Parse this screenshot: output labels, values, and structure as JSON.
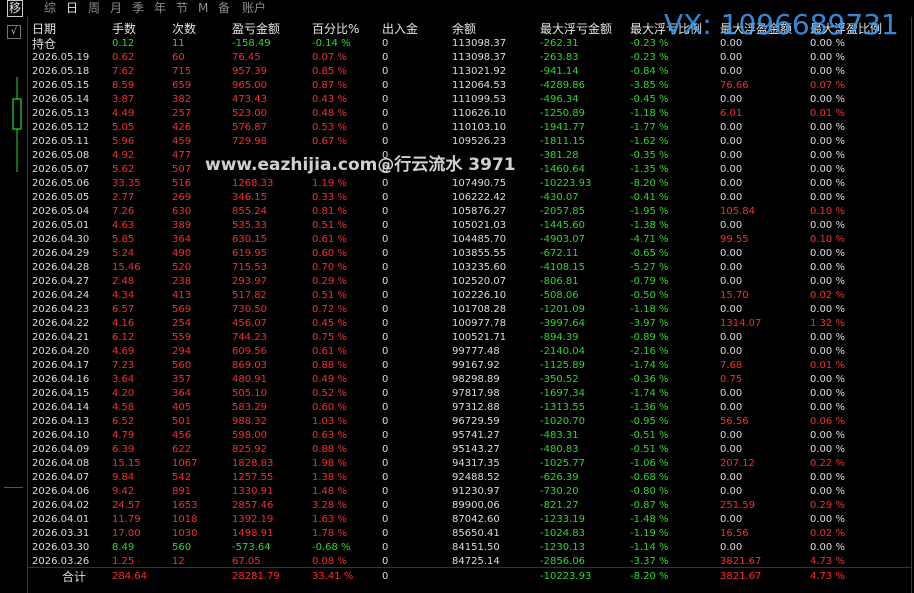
{
  "tabs": [
    "移",
    "综",
    "日",
    "周",
    "月",
    "季",
    "年",
    "节",
    "M",
    "备",
    "账户"
  ],
  "left_button": "√",
  "watermark": "www.eazhijia.com@行云流水 3971",
  "vx_watermark": "VX: 1096689731",
  "columns": [
    "日期",
    "手数",
    "次数",
    "盈亏金额",
    "百分比%",
    "出入金",
    "余额",
    "最大浮亏金额",
    "最大浮亏比例",
    "最大浮盈金额",
    "最大浮盈比例"
  ],
  "rows": [
    [
      "持仓",
      "0.12",
      "11",
      "-158.49",
      "-0.14 %",
      "0",
      "113098.37",
      "-262.31",
      "-0.23 %",
      "0.00",
      "0.00 %"
    ],
    [
      "2026.05.19",
      "0.62",
      "60",
      "76.45",
      "0.07 %",
      "0",
      "113098.37",
      "-263.83",
      "-0.23 %",
      "0.00",
      "0.00 %"
    ],
    [
      "2026.05.18",
      "7.62",
      "715",
      "957.39",
      "0.85 %",
      "0",
      "113021.92",
      "-941.14",
      "-0.84 %",
      "0.00",
      "0.00 %"
    ],
    [
      "2026.05.15",
      "8.59",
      "659",
      "965.00",
      "0.87 %",
      "0",
      "112064.53",
      "-4289.86",
      "-3.85 %",
      "76.66",
      "0.07 %"
    ],
    [
      "2026.05.14",
      "3.87",
      "382",
      "473.43",
      "0.43 %",
      "0",
      "111099.53",
      "-496.34",
      "-0.45 %",
      "0.00",
      "0.00 %"
    ],
    [
      "2026.05.13",
      "4.49",
      "257",
      "523.00",
      "0.48 %",
      "0",
      "110626.10",
      "-1250.89",
      "-1.18 %",
      "6.01",
      "0.01 %"
    ],
    [
      "2026.05.12",
      "5.05",
      "426",
      "576.87",
      "0.53 %",
      "0",
      "110103.10",
      "-1941.77",
      "-1.77 %",
      "0.00",
      "0.00 %"
    ],
    [
      "2026.05.11",
      "5.96",
      "459",
      "729.98",
      "0.67 %",
      "0",
      "109526.23",
      "-1811.15",
      "-1.62 %",
      "0.00",
      "0.00 %"
    ],
    [
      "2026.05.08",
      "4.92",
      "477",
      "",
      "",
      "0",
      "",
      "-381.28",
      "-0.35 %",
      "0.00",
      "0.00 %"
    ],
    [
      "2026.05.07",
      "5.62",
      "507",
      "",
      "",
      "0",
      "",
      "-1460.64",
      "-1.35 %",
      "0.00",
      "0.00 %"
    ],
    [
      "2026.05.06",
      "33.35",
      "516",
      "1268.33",
      "1.19 %",
      "0",
      "107490.75",
      "-10223.93",
      "-8.20 %",
      "0.00",
      "0.00 %"
    ],
    [
      "2026.05.05",
      "2.77",
      "269",
      "346.15",
      "0.33 %",
      "0",
      "106222.42",
      "-430.07",
      "-0.41 %",
      "0.00",
      "0.00 %"
    ],
    [
      "2026.05.04",
      "7.26",
      "630",
      "855.24",
      "0.81 %",
      "0",
      "105876.27",
      "-2057.85",
      "-1.95 %",
      "105.84",
      "0.10 %"
    ],
    [
      "2026.05.01",
      "4.63",
      "389",
      "535.33",
      "0.51 %",
      "0",
      "105021.03",
      "-1445.60",
      "-1.38 %",
      "0.00",
      "0.00 %"
    ],
    [
      "2026.04.30",
      "5.85",
      "364",
      "630.15",
      "0.61 %",
      "0",
      "104485.70",
      "-4903.07",
      "-4.71 %",
      "99.55",
      "0.10 %"
    ],
    [
      "2026.04.29",
      "5.24",
      "490",
      "619.95",
      "0.60 %",
      "0",
      "103855.55",
      "-672.11",
      "-0.65 %",
      "0.00",
      "0.00 %"
    ],
    [
      "2026.04.28",
      "15.46",
      "520",
      "715.53",
      "0.70 %",
      "0",
      "103235.60",
      "-4108.15",
      "-5.27 %",
      "0.00",
      "0.00 %"
    ],
    [
      "2026.04.27",
      "2.48",
      "238",
      "293.97",
      "0.29 %",
      "0",
      "102520.07",
      "-806.81",
      "-0.79 %",
      "0.00",
      "0.00 %"
    ],
    [
      "2026.04.24",
      "4.34",
      "413",
      "517.82",
      "0.51 %",
      "0",
      "102226.10",
      "-508.06",
      "-0.50 %",
      "15.70",
      "0.02 %"
    ],
    [
      "2026.04.23",
      "6.57",
      "569",
      "730.50",
      "0.72 %",
      "0",
      "101708.28",
      "-1201.09",
      "-1.18 %",
      "0.00",
      "0.00 %"
    ],
    [
      "2026.04.22",
      "4.16",
      "254",
      "456.07",
      "0.45 %",
      "0",
      "100977.78",
      "-3997.64",
      "-3.97 %",
      "1314.07",
      "1.32 %"
    ],
    [
      "2026.04.21",
      "6.12",
      "559",
      "744.23",
      "0.75 %",
      "0",
      "100521.71",
      "-894.39",
      "-0.89 %",
      "0.00",
      "0.00 %"
    ],
    [
      "2026.04.20",
      "4.69",
      "294",
      "609.56",
      "0.61 %",
      "0",
      "99777.48",
      "-2140.04",
      "-2.16 %",
      "0.00",
      "0.00 %"
    ],
    [
      "2026.04.17",
      "7.23",
      "560",
      "869.03",
      "0.88 %",
      "0",
      "99167.92",
      "-1125.89",
      "-1.74 %",
      "7.68",
      "0.01 %"
    ],
    [
      "2026.04.16",
      "3.64",
      "357",
      "480.91",
      "0.49 %",
      "0",
      "98298.89",
      "-350.52",
      "-0.36 %",
      "0.75",
      "0.00 %"
    ],
    [
      "2026.04.15",
      "4.20",
      "364",
      "505.10",
      "0.52 %",
      "0",
      "97817.98",
      "-1697.34",
      "-1.74 %",
      "0.00",
      "0.00 %"
    ],
    [
      "2026.04.14",
      "4.58",
      "405",
      "583.29",
      "0.60 %",
      "0",
      "97312.88",
      "-1313.55",
      "-1.36 %",
      "0.00",
      "0.00 %"
    ],
    [
      "2026.04.13",
      "6.52",
      "501",
      "988.32",
      "1.03 %",
      "0",
      "96729.59",
      "-1020.70",
      "-0.95 %",
      "56.56",
      "0.06 %"
    ],
    [
      "2026.04.10",
      "4.79",
      "456",
      "598.00",
      "0.63 %",
      "0",
      "95741.27",
      "-483.31",
      "-0.51 %",
      "0.00",
      "0.00 %"
    ],
    [
      "2026.04.09",
      "6.39",
      "622",
      "825.92",
      "0.88 %",
      "0",
      "95143.27",
      "-480.83",
      "-0.51 %",
      "0.00",
      "0.00 %"
    ],
    [
      "2026.04.08",
      "15.15",
      "1067",
      "1828.83",
      "1.98 %",
      "0",
      "94317.35",
      "-1025.77",
      "-1.06 %",
      "207.12",
      "0.22 %"
    ],
    [
      "2026.04.07",
      "9.84",
      "542",
      "1257.55",
      "1.38 %",
      "0",
      "92488.52",
      "-626.39",
      "-0.68 %",
      "0.00",
      "0.00 %"
    ],
    [
      "2026.04.06",
      "9.42",
      "891",
      "1330.91",
      "1.48 %",
      "0",
      "91230.97",
      "-730.20",
      "-0.80 %",
      "0.00",
      "0.00 %"
    ],
    [
      "2026.04.02",
      "24.57",
      "1653",
      "2857.46",
      "3.28 %",
      "0",
      "89900.06",
      "-821.27",
      "-0.87 %",
      "251.59",
      "0.29 %"
    ],
    [
      "2026.04.01",
      "11.79",
      "1018",
      "1392.19",
      "1.63 %",
      "0",
      "87042.60",
      "-1233.19",
      "-1.48 %",
      "0.00",
      "0.00 %"
    ],
    [
      "2026.03.31",
      "17.00",
      "1030",
      "1498.91",
      "1.78 %",
      "0",
      "85650.41",
      "-1024.83",
      "-1.19 %",
      "16.56",
      "0.02 %"
    ],
    [
      "2026.03.30",
      "8.49",
      "560",
      "-573.64",
      "-0.68 %",
      "0",
      "84151.50",
      "-1230.13",
      "-1.14 %",
      "0.00",
      "0.00 %"
    ],
    [
      "2026.03.26",
      "1.25",
      "12",
      "67.05",
      "0.08 %",
      "0",
      "84725.14",
      "-2856.06",
      "-3.37 %",
      "3821.67",
      "4.73 %"
    ]
  ],
  "totals": [
    "合计",
    "284.64",
    "",
    "28281.79",
    "33.41 %",
    "0",
    "",
    "-10223.93",
    "-8.20 %",
    "3821.67",
    "4.73 %"
  ]
}
